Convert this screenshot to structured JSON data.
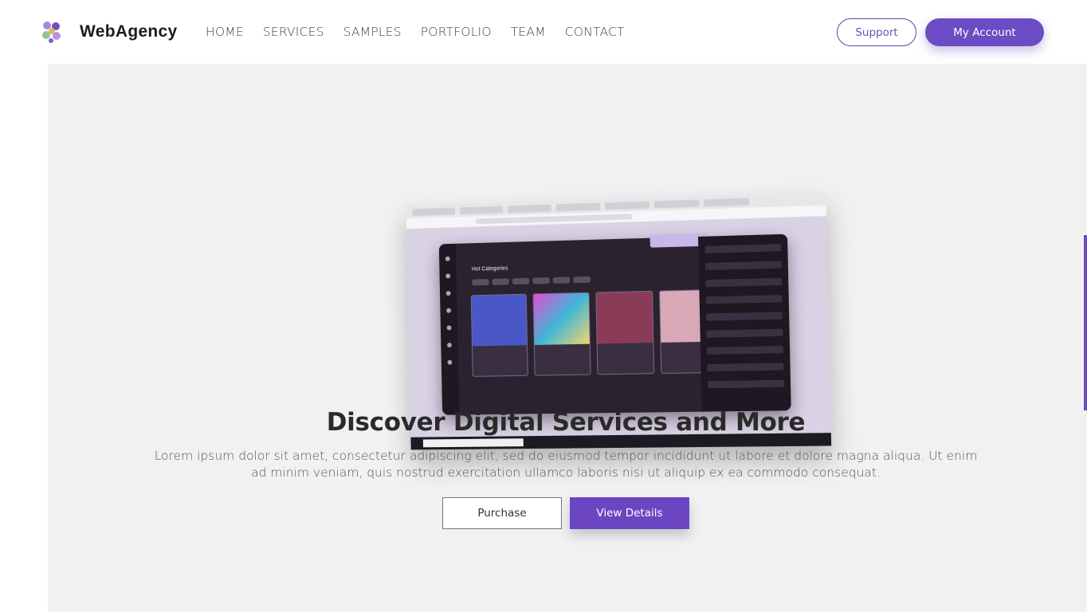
{
  "nav": {
    "brand": "WebAgency",
    "logo_icon": "flower-logo-icon",
    "menu": [
      "HOME",
      "SERVICES",
      "SAMPLES",
      "PORTFOLIO",
      "TEAM",
      "CONTACT"
    ],
    "support_label": "Support",
    "account_label": "My Account"
  },
  "hero": {
    "title": "Discover Digital Services and More",
    "description": "Lorem ipsum dolor sit amet, consectetur adipiscing elit, sed do eiusmod tempor incididunt ut labore et dolore magna aliqua. Ut enim ad minim veniam, quis nostrud exercitation ullamco laboris nisi ut aliquip ex ea commodo consequat.",
    "purchase_label": "Purchase",
    "details_label": "View Details",
    "mockup_heading": "Hot Categories"
  },
  "colors": {
    "accent": "#6c4bc4",
    "hero_bg": "#f1f1f2"
  }
}
